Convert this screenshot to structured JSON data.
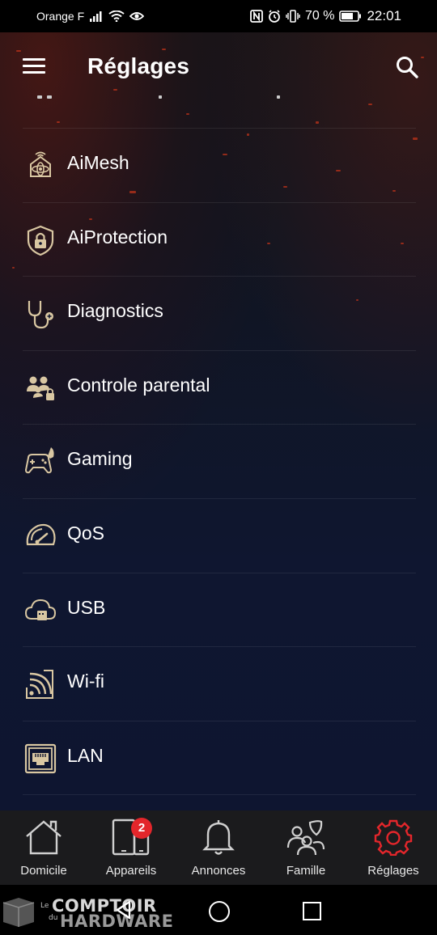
{
  "status_bar": {
    "carrier": "Orange F",
    "battery_text": "70 %",
    "time": "22:01",
    "icons": [
      "signal-icon",
      "wifi-icon",
      "eye-icon",
      "nfc-icon",
      "alarm-icon",
      "vibrate-icon",
      "battery-icon"
    ]
  },
  "header": {
    "title": "Réglages",
    "menu_icon": "hamburger-menu-icon",
    "search_icon": "search-icon"
  },
  "settings_list": [
    {
      "label": "AiMesh",
      "icon": "aimesh-icon"
    },
    {
      "label": "AiProtection",
      "icon": "shield-lock-icon"
    },
    {
      "label": "Diagnostics",
      "icon": "stethoscope-icon"
    },
    {
      "label": "Controle parental",
      "icon": "parental-control-icon"
    },
    {
      "label": "Gaming",
      "icon": "gamepad-rocket-icon"
    },
    {
      "label": "QoS",
      "icon": "speedometer-icon"
    },
    {
      "label": "USB",
      "icon": "cloud-usb-icon"
    },
    {
      "label": "Wi-fi",
      "icon": "wifi-tablet-icon"
    },
    {
      "label": "LAN",
      "icon": "ethernet-port-icon"
    }
  ],
  "bottom_nav": {
    "tabs": [
      {
        "label": "Domicile",
        "icon": "home-icon"
      },
      {
        "label": "Appareils",
        "icon": "devices-icon",
        "badge": "2"
      },
      {
        "label": "Annonces",
        "icon": "bell-icon"
      },
      {
        "label": "Famille",
        "icon": "family-icon"
      },
      {
        "label": "Réglages",
        "icon": "gear-icon",
        "active": true
      }
    ],
    "active_color": "#e3262b"
  },
  "system_nav": {
    "icons": [
      "back-icon",
      "home-circle-icon",
      "recents-icon"
    ]
  },
  "watermark": {
    "prefix_le": "Le",
    "prefix_du": "du",
    "line1": "COMPTOIR",
    "line2": "HARDWARE"
  },
  "colors": {
    "accent_gold": "#d9c7a2",
    "badge_red": "#e3262b",
    "background": "#0f1630"
  }
}
